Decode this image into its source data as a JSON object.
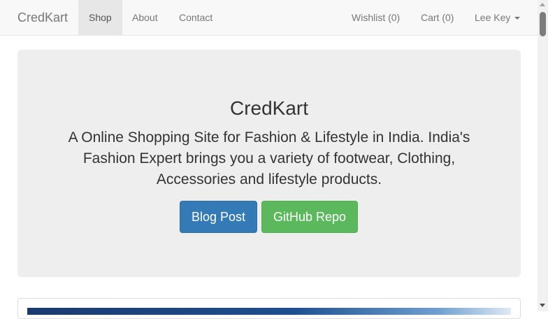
{
  "navbar": {
    "brand": "CredKart",
    "left_links": [
      {
        "label": "Shop",
        "active": true
      },
      {
        "label": "About",
        "active": false
      },
      {
        "label": "Contact",
        "active": false
      }
    ],
    "right_links": {
      "wishlist": "Wishlist (0)",
      "cart": "Cart (0)",
      "user": "Lee Key"
    }
  },
  "jumbotron": {
    "title": "CredKart",
    "description": "A Online Shopping Site for Fashion & Lifestyle in India. India's Fashion Expert brings you a variety of footwear, Clothing, Accessories and lifestyle products.",
    "buttons": {
      "blog": "Blog Post",
      "github": "GitHub Repo"
    }
  },
  "colors": {
    "primary": "#337ab7",
    "success": "#5cb85c",
    "jumbotron_bg": "#eeeeee",
    "navbar_bg": "#f8f8f8"
  }
}
